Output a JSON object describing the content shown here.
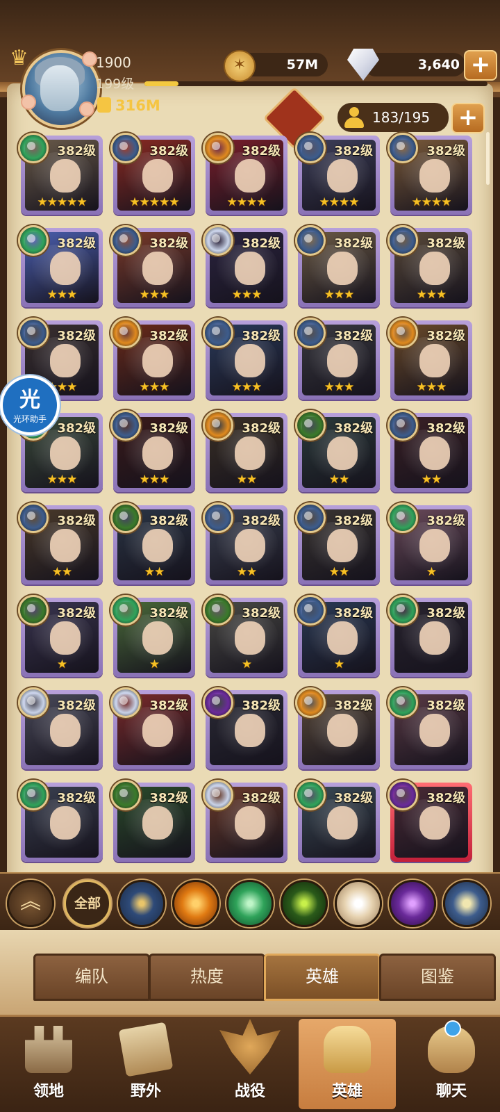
{
  "player": {
    "level_number": "1900",
    "level_label": "199级",
    "power": "316M",
    "xp_progress": 0.1
  },
  "currency": {
    "gold": "57M",
    "diamonds": "3,640"
  },
  "roster": {
    "count": "183/195"
  },
  "colors": {
    "parchment": "#eadbb5",
    "frame_brown": "#5a3a20",
    "gold_text": "#f5c542",
    "card_purple": "#9a82c6",
    "card_red": "#d23a4b"
  },
  "heroes": [
    {
      "level": "382级",
      "stars": "★★★★★",
      "faction": "forest",
      "theme": "#6a5b4a"
    },
    {
      "level": "382级",
      "stars": "★★★★★",
      "faction": "celestial",
      "theme": "#8a2a22"
    },
    {
      "level": "382级",
      "stars": "★★★★",
      "faction": "holy",
      "theme": "#7a1e2a"
    },
    {
      "level": "382级",
      "stars": "★★★★",
      "faction": "celestial",
      "theme": "#3d3f5a"
    },
    {
      "level": "382级",
      "stars": "★★★★",
      "faction": "celestial",
      "theme": "#7a5a3a"
    },
    {
      "level": "382级",
      "stars": "★★★",
      "faction": "forest",
      "theme": "#4b5fb0"
    },
    {
      "level": "382级",
      "stars": "★★★",
      "faction": "celestial",
      "theme": "#7a3a2a"
    },
    {
      "level": "382级",
      "stars": "★★★",
      "faction": "light",
      "theme": "#2b2440"
    },
    {
      "level": "382级",
      "stars": "★★★",
      "faction": "celestial",
      "theme": "#6b5a45"
    },
    {
      "level": "382级",
      "stars": "★★★",
      "faction": "celestial",
      "theme": "#5a4a3a"
    },
    {
      "level": "382级",
      "stars": "★★★",
      "faction": "celestial",
      "theme": "#3a3030"
    },
    {
      "level": "382级",
      "stars": "★★★",
      "faction": "holy",
      "theme": "#6a2a1a"
    },
    {
      "level": "382级",
      "stars": "★★★",
      "faction": "celestial",
      "theme": "#2a3a5a"
    },
    {
      "level": "382级",
      "stars": "★★★",
      "faction": "celestial",
      "theme": "#3a3a40"
    },
    {
      "level": "382级",
      "stars": "★★★",
      "faction": "holy",
      "theme": "#6a4a2a"
    },
    {
      "level": "382级",
      "stars": "★★★",
      "faction": "forest",
      "theme": "#3a4a3a"
    },
    {
      "level": "382级",
      "stars": "★★★",
      "faction": "celestial",
      "theme": "#3a1a1a"
    },
    {
      "level": "382级",
      "stars": "★★",
      "faction": "holy",
      "theme": "#3a3025"
    },
    {
      "level": "382级",
      "stars": "★★",
      "faction": "wilder",
      "theme": "#2a3a3a"
    },
    {
      "level": "382级",
      "stars": "★★",
      "faction": "celestial",
      "theme": "#3a2025"
    },
    {
      "level": "382级",
      "stars": "★★",
      "faction": "celestial",
      "theme": "#4a3a2a"
    },
    {
      "level": "382级",
      "stars": "★★",
      "faction": "wilder",
      "theme": "#2a3545"
    },
    {
      "level": "382级",
      "stars": "★★",
      "faction": "celestial",
      "theme": "#3a4050"
    },
    {
      "level": "382级",
      "stars": "★★",
      "faction": "celestial",
      "theme": "#3a3532"
    },
    {
      "level": "382级",
      "stars": "★",
      "faction": "forest",
      "theme": "#6a4a5a"
    },
    {
      "level": "382级",
      "stars": "★",
      "faction": "wilder",
      "theme": "#3a3550"
    },
    {
      "level": "382级",
      "stars": "★",
      "faction": "forest",
      "theme": "#4a6a3a"
    },
    {
      "level": "382级",
      "stars": "★",
      "faction": "wilder",
      "theme": "#4a4a45"
    },
    {
      "level": "382级",
      "stars": "★",
      "faction": "celestial",
      "theme": "#2a3a55"
    },
    {
      "level": "382级",
      "stars": "",
      "faction": "forest",
      "theme": "#2a2530"
    },
    {
      "level": "382级",
      "stars": "",
      "faction": "light",
      "theme": "#4a4a5a"
    },
    {
      "level": "382级",
      "stars": "",
      "faction": "light",
      "theme": "#7a2a2a"
    },
    {
      "level": "382级",
      "stars": "",
      "faction": "void",
      "theme": "#2a2a35"
    },
    {
      "level": "382级",
      "stars": "",
      "faction": "holy",
      "theme": "#5a4a3a"
    },
    {
      "level": "382级",
      "stars": "",
      "faction": "forest",
      "theme": "#5a3a45"
    },
    {
      "level": "382级",
      "stars": "",
      "faction": "forest",
      "theme": "#3a4050"
    },
    {
      "level": "382级",
      "stars": "",
      "faction": "wilder",
      "theme": "#2a4a2a"
    },
    {
      "level": "382级",
      "stars": "",
      "faction": "light",
      "theme": "#6a3a2a"
    },
    {
      "level": "382级",
      "stars": "",
      "faction": "forest",
      "theme": "#3a4a55"
    },
    {
      "level": "382级",
      "stars": "",
      "faction": "void",
      "theme": "#4a2a35"
    }
  ],
  "faction_colors": {
    "forest": "#2fa35a",
    "celestial": "#3d5c8c",
    "holy": "#e08a1e",
    "light": "#c9d3e8",
    "wilder": "#3a7a2a",
    "void": "#6a2a9a"
  },
  "helper": {
    "char": "光",
    "label": "光环助手"
  },
  "filters": {
    "all_label": "全部",
    "collapse": "︽",
    "icons": [
      "celestial-star",
      "holy-sun",
      "forest-leaf",
      "wilder-eye",
      "light-star",
      "void-orb",
      "celestial-moon"
    ]
  },
  "tabs": [
    "编队",
    "热度",
    "英雄",
    "图鉴"
  ],
  "nav": [
    "领地",
    "野外",
    "战役",
    "英雄",
    "聊天"
  ]
}
